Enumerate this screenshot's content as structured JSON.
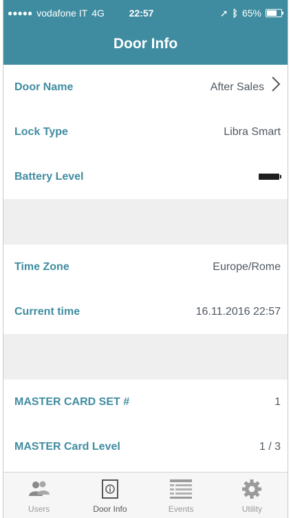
{
  "status_bar": {
    "carrier": "vodafone IT",
    "network": "4G",
    "time": "22:57",
    "battery_percent": "65%"
  },
  "header": {
    "title": "Door Info"
  },
  "rows": [
    {
      "label": "Door Name",
      "value": "After Sales"
    },
    {
      "label": "Lock Type",
      "value": "Libra Smart"
    },
    {
      "label": "Battery Level",
      "value": ""
    },
    {
      "label": "Time Zone",
      "value": "Europe/Rome"
    },
    {
      "label": "Current time",
      "value": "16.11.2016 22:57"
    },
    {
      "label": "MASTER CARD SET #",
      "value": "1"
    },
    {
      "label": "MASTER Card Level",
      "value": "1 / 3"
    }
  ],
  "tabs": [
    {
      "label": "Users",
      "icon": "users-icon"
    },
    {
      "label": "Door Info",
      "icon": "door-info-icon"
    },
    {
      "label": "Events",
      "icon": "events-list-icon"
    },
    {
      "label": "Utility",
      "icon": "gear-icon"
    }
  ],
  "colors": {
    "accent": "#3f8ca1",
    "section_gap": "#efefef"
  }
}
